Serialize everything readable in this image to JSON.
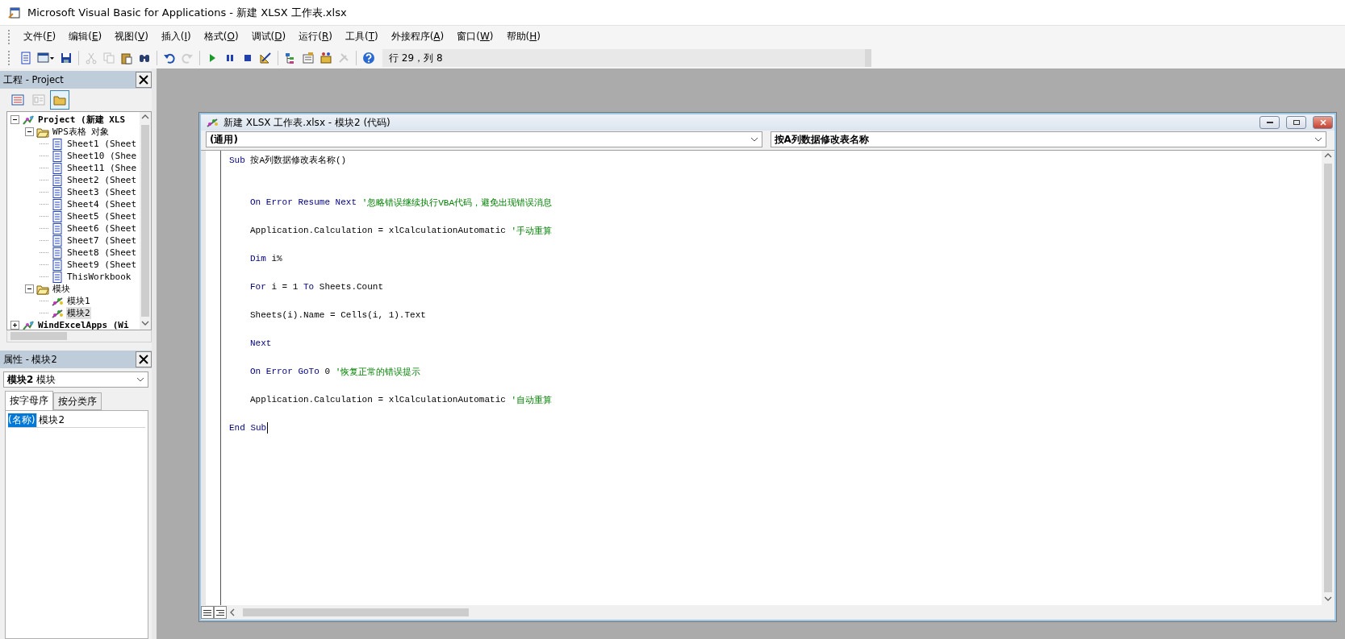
{
  "window": {
    "title": "Microsoft Visual Basic for Applications - 新建 XLSX 工作表.xlsx"
  },
  "menu": [
    {
      "text": "文件(",
      "key": "F",
      "tail": ")"
    },
    {
      "text": "编辑(",
      "key": "E",
      "tail": ")"
    },
    {
      "text": "视图(",
      "key": "V",
      "tail": ")"
    },
    {
      "text": "插入(",
      "key": "I",
      "tail": ")"
    },
    {
      "text": "格式(",
      "key": "O",
      "tail": ")"
    },
    {
      "text": "调试(",
      "key": "D",
      "tail": ")"
    },
    {
      "text": "运行(",
      "key": "R",
      "tail": ")"
    },
    {
      "text": "工具(",
      "key": "T",
      "tail": ")"
    },
    {
      "text": "外接程序(",
      "key": "A",
      "tail": ")"
    },
    {
      "text": "窗口(",
      "key": "W",
      "tail": ")"
    },
    {
      "text": "帮助(",
      "key": "H",
      "tail": ")"
    }
  ],
  "toolbar": {
    "buttons": [
      {
        "kind": "sheet",
        "disabled": false
      },
      {
        "kind": "form",
        "disabled": false
      },
      {
        "kind": "save",
        "disabled": false
      },
      {
        "kind": "separator"
      },
      {
        "kind": "cut",
        "disabled": true
      },
      {
        "kind": "copy",
        "disabled": true
      },
      {
        "kind": "paste",
        "disabled": false
      },
      {
        "kind": "find",
        "disabled": false
      },
      {
        "kind": "separator"
      },
      {
        "kind": "undo",
        "disabled": false
      },
      {
        "kind": "redo",
        "disabled": true
      },
      {
        "kind": "separator"
      },
      {
        "kind": "run",
        "disabled": false
      },
      {
        "kind": "pause",
        "disabled": false
      },
      {
        "kind": "stop",
        "disabled": false
      },
      {
        "kind": "design",
        "disabled": false
      },
      {
        "kind": "separator"
      },
      {
        "kind": "explorer",
        "disabled": false
      },
      {
        "kind": "properties",
        "disabled": false
      },
      {
        "kind": "browser",
        "disabled": false
      },
      {
        "kind": "tools",
        "disabled": true
      },
      {
        "kind": "separator"
      },
      {
        "kind": "help",
        "disabled": false
      }
    ],
    "position": "行 29，列 8"
  },
  "project": {
    "title": "工程 - Project",
    "buttons": [
      {
        "kind": "code",
        "disabled": false,
        "selected": false
      },
      {
        "kind": "object",
        "disabled": true,
        "selected": false
      },
      {
        "kind": "folders",
        "disabled": false,
        "selected": true
      }
    ],
    "tree": [
      {
        "label": "Project (新建 XLS",
        "kind": "project",
        "expanded": true,
        "selected": false,
        "children": [
          {
            "label": "WPS表格 对象",
            "kind": "folder",
            "expanded": true,
            "selected": false,
            "children": [
              {
                "label": "Sheet1 (Sheet",
                "kind": "sheet",
                "selected": false
              },
              {
                "label": "Sheet10 (Shee",
                "kind": "sheet",
                "selected": false
              },
              {
                "label": "Sheet11 (Shee",
                "kind": "sheet",
                "selected": false
              },
              {
                "label": "Sheet2 (Sheet",
                "kind": "sheet",
                "selected": false
              },
              {
                "label": "Sheet3 (Sheet",
                "kind": "sheet",
                "selected": false
              },
              {
                "label": "Sheet4 (Sheet",
                "kind": "sheet",
                "selected": false
              },
              {
                "label": "Sheet5 (Sheet",
                "kind": "sheet",
                "selected": false
              },
              {
                "label": "Sheet6 (Sheet",
                "kind": "sheet",
                "selected": false
              },
              {
                "label": "Sheet7 (Sheet",
                "kind": "sheet",
                "selected": false
              },
              {
                "label": "Sheet8 (Sheet",
                "kind": "sheet",
                "selected": false
              },
              {
                "label": "Sheet9 (Sheet",
                "kind": "sheet",
                "selected": false
              },
              {
                "label": "ThisWorkbook",
                "kind": "sheet",
                "selected": false
              }
            ]
          },
          {
            "label": "模块",
            "kind": "folder",
            "expanded": true,
            "selected": false,
            "children": [
              {
                "label": "模块1",
                "kind": "module",
                "selected": false
              },
              {
                "label": "模块2",
                "kind": "module",
                "selected": true
              }
            ]
          }
        ]
      },
      {
        "label": "WindExcelApps (Wi",
        "kind": "project",
        "expanded": false,
        "selected": false
      }
    ]
  },
  "properties": {
    "title": "属性 - 模块2",
    "object": "**模块2** 模块",
    "tabs": [
      {
        "label": "按字母序",
        "selected": true
      },
      {
        "label": "按分类序",
        "selected": false
      }
    ],
    "rows": [
      {
        "name": "(名称)",
        "value": "模块2",
        "selected": true
      }
    ]
  },
  "code_window": {
    "title": "新建 XLSX 工作表.xlsx - 模块2 (代码)",
    "object_combo": "(通用)",
    "procedure_combo": "按A列数据修改表名称",
    "lines": [
      {
        "kind": "code",
        "indent": false,
        "caret": false,
        "segments": [
          {
            "kind": "keyword",
            "text": "Sub"
          },
          {
            "kind": "plain",
            "text": "按A列数据修改表名称()"
          }
        ]
      },
      {
        "kind": "blank"
      },
      {
        "kind": "blank"
      },
      {
        "kind": "code",
        "indent": true,
        "caret": false,
        "segments": [
          {
            "kind": "keyword",
            "text": "On Error Resume Next"
          },
          {
            "kind": "comment",
            "text": "'忽略错误继续执行VBA代码，避免出现错误消息"
          }
        ]
      },
      {
        "kind": "blank"
      },
      {
        "kind": "code",
        "indent": true,
        "caret": false,
        "segments": [
          {
            "kind": "plain",
            "text": "Application.Calculation = xlCalculationAutomatic"
          },
          {
            "kind": "comment",
            "text": "'手动重算"
          }
        ]
      },
      {
        "kind": "blank"
      },
      {
        "kind": "code",
        "indent": true,
        "caret": false,
        "segments": [
          {
            "kind": "keyword",
            "text": "Dim"
          },
          {
            "kind": "plain",
            "text": "i%"
          }
        ]
      },
      {
        "kind": "blank"
      },
      {
        "kind": "code",
        "indent": true,
        "caret": false,
        "segments": [
          {
            "kind": "keyword",
            "text": "For"
          },
          {
            "kind": "plain",
            "text": "i = 1"
          },
          {
            "kind": "keyword",
            "text": "To"
          },
          {
            "kind": "plain",
            "text": "Sheets.Count"
          }
        ]
      },
      {
        "kind": "blank"
      },
      {
        "kind": "code",
        "indent": true,
        "caret": false,
        "segments": [
          {
            "kind": "plain",
            "text": "Sheets(i).Name = Cells(i, 1).Text"
          }
        ]
      },
      {
        "kind": "blank"
      },
      {
        "kind": "code",
        "indent": true,
        "caret": false,
        "segments": [
          {
            "kind": "keyword",
            "text": "Next"
          }
        ]
      },
      {
        "kind": "blank"
      },
      {
        "kind": "code",
        "indent": true,
        "caret": false,
        "segments": [
          {
            "kind": "keyword",
            "text": "On Error GoTo"
          },
          {
            "kind": "plain",
            "text": "0"
          },
          {
            "kind": "comment",
            "text": "'恢复正常的错误提示"
          }
        ]
      },
      {
        "kind": "blank"
      },
      {
        "kind": "code",
        "indent": true,
        "caret": false,
        "segments": [
          {
            "kind": "plain",
            "text": "Application.Calculation = xlCalculationAutomatic"
          },
          {
            "kind": "comment",
            "text": "'自动重算"
          }
        ]
      },
      {
        "kind": "blank"
      },
      {
        "kind": "code",
        "indent": false,
        "caret": true,
        "segments": [
          {
            "kind": "keyword",
            "text": "End Sub"
          }
        ]
      }
    ]
  }
}
